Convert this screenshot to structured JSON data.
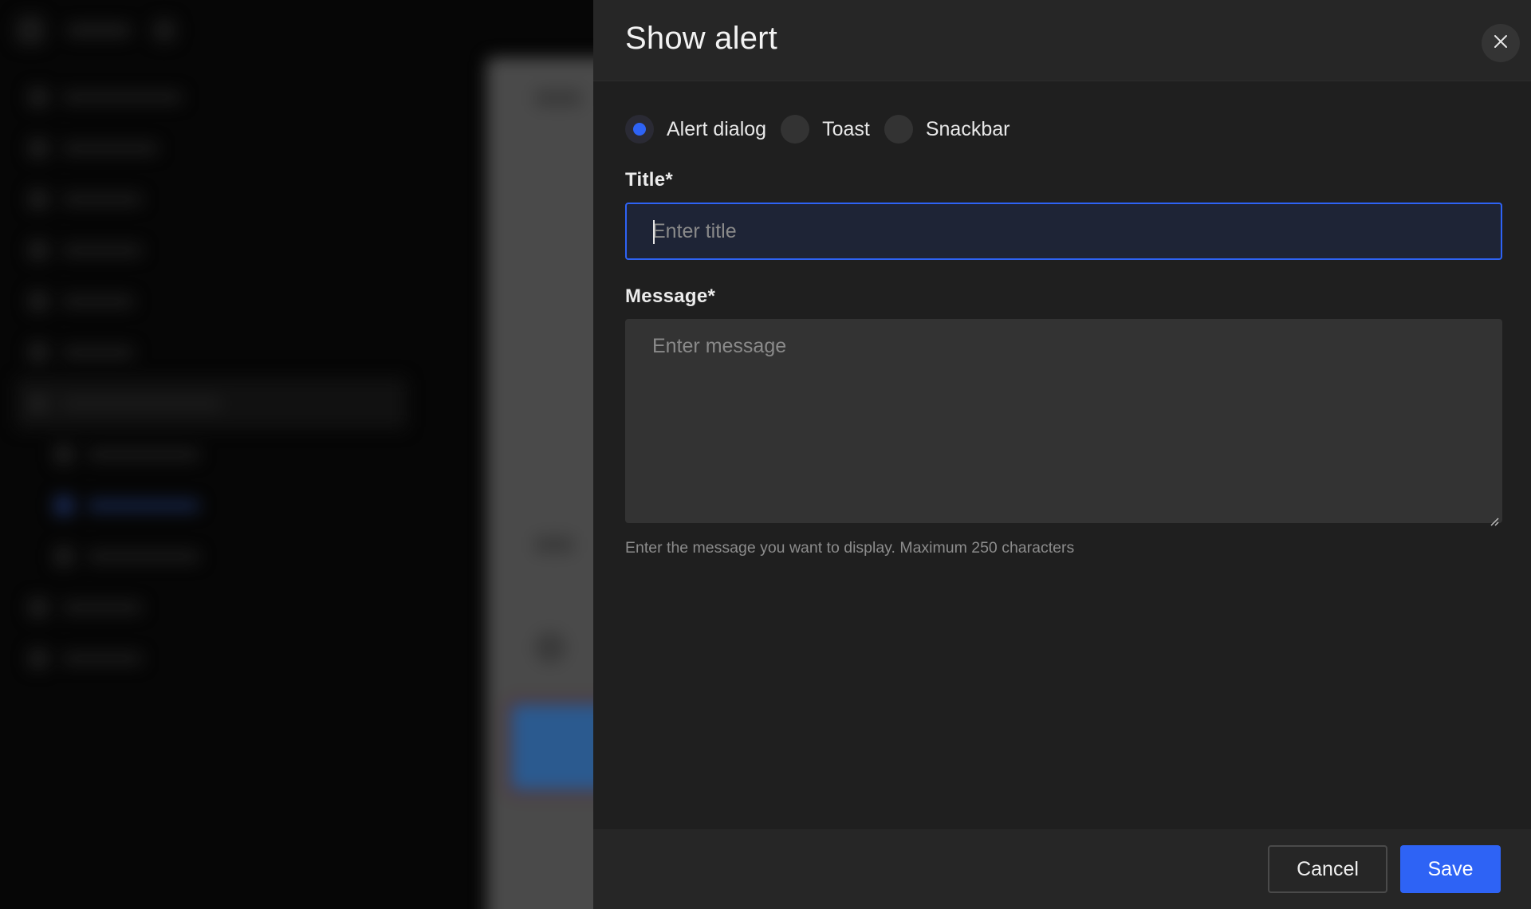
{
  "drawer": {
    "title": "Show alert",
    "close_icon": "close-icon"
  },
  "alert_type": {
    "options": [
      {
        "label": "Alert dialog",
        "checked": true
      },
      {
        "label": "Toast",
        "checked": false
      },
      {
        "label": "Snackbar",
        "checked": false
      }
    ]
  },
  "title_field": {
    "label": "Title*",
    "placeholder": "Enter title",
    "value": ""
  },
  "message_field": {
    "label": "Message*",
    "placeholder": "Enter message",
    "value": "",
    "help": "Enter the message you want to display. Maximum 250 characters"
  },
  "footer": {
    "cancel_label": "Cancel",
    "save_label": "Save"
  },
  "colors": {
    "accent": "#2e63f5",
    "panel": "#1f1f1f",
    "header": "#262626"
  }
}
